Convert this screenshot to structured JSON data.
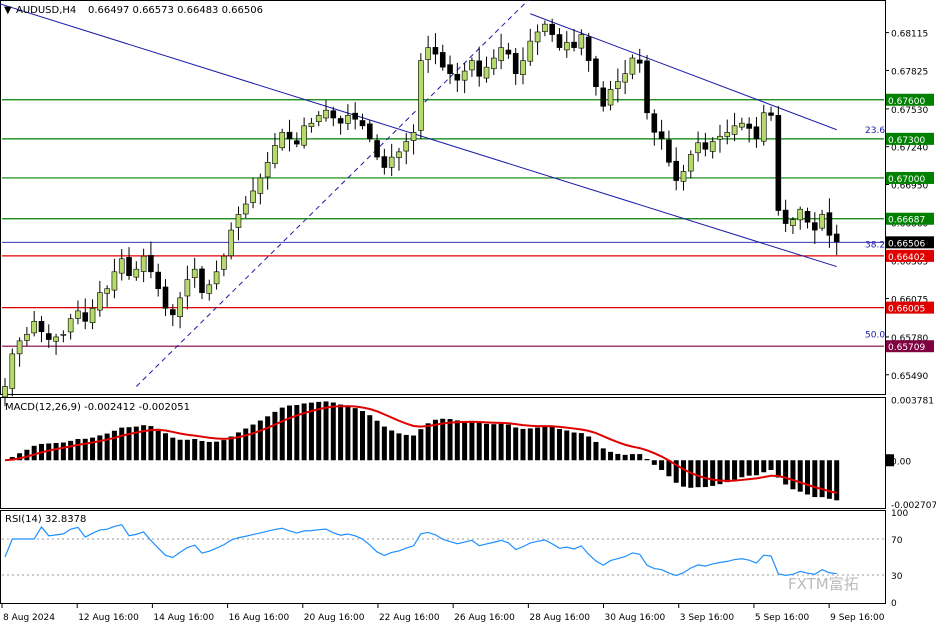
{
  "header": {
    "symbol": "AUDUSD,H4",
    "ohlc": "0.66497 0.66573 0.66483 0.66506"
  },
  "colors": {
    "background": "#ffffff",
    "bull_candle": "#b5d96a",
    "bear_candle": "#000000",
    "trend_lines": "#1a1aa8",
    "fib_green": "#008000",
    "fib_red": "#e00000",
    "fib_dark": "#800040",
    "macd_signal": "#e00000",
    "rsi": "#1e90ff",
    "price_box": "#000000"
  },
  "chart_data": [
    {
      "type": "candlestick",
      "symbol": "AUDUSD",
      "timeframe": "H4",
      "title": "AUDUSD,H4",
      "last_price": 0.66506,
      "ylim": [
        0.6535,
        0.6835
      ],
      "y_ticks": [
        "0.68115",
        "0.67825",
        "0.67530",
        "0.67240",
        "0.66950",
        "0.66660",
        "0.66365",
        "0.66075",
        "0.65780",
        "0.65490"
      ],
      "x_labels": [
        "8 Aug 2024",
        "12 Aug 16:00",
        "14 Aug 16:00",
        "16 Aug 16:00",
        "20 Aug 16:00",
        "22 Aug 16:00",
        "26 Aug 16:00",
        "28 Aug 16:00",
        "30 Aug 16:00",
        "3 Sep 16:00",
        "5 Sep 16:00",
        "9 Sep 16:00"
      ],
      "price_tags": [
        {
          "value": 0.676,
          "label": "0.67600",
          "style": "green"
        },
        {
          "value": 0.673,
          "label": "0.67300",
          "style": "green"
        },
        {
          "value": 0.67,
          "label": "0.67000",
          "style": "green"
        },
        {
          "value": 0.66687,
          "label": "0.66687",
          "style": "green"
        },
        {
          "value": 0.66506,
          "label": "0.66506",
          "style": "current"
        },
        {
          "value": 0.66402,
          "label": "0.66402",
          "style": "red"
        },
        {
          "value": 0.66005,
          "label": "0.66005",
          "style": "red"
        },
        {
          "value": 0.65709,
          "label": "0.65709",
          "style": "dark"
        }
      ],
      "fib_labels": [
        {
          "value": 0.6733,
          "label": "23.6"
        },
        {
          "value": 0.6645,
          "label": "38.2"
        },
        {
          "value": 0.6576,
          "label": "50.0"
        }
      ],
      "closes": [
        0.654,
        0.6565,
        0.6575,
        0.658,
        0.659,
        0.6582,
        0.6576,
        0.6578,
        0.658,
        0.6592,
        0.6598,
        0.659,
        0.66,
        0.6612,
        0.6615,
        0.6628,
        0.6638,
        0.6625,
        0.663,
        0.664,
        0.6628,
        0.6615,
        0.66,
        0.6595,
        0.6608,
        0.6622,
        0.663,
        0.6612,
        0.6618,
        0.6628,
        0.664,
        0.666,
        0.6672,
        0.668,
        0.669,
        0.67,
        0.6712,
        0.6725,
        0.6735,
        0.673,
        0.6726,
        0.674,
        0.6742,
        0.6748,
        0.6752,
        0.6746,
        0.6742,
        0.6748,
        0.6745,
        0.674,
        0.673,
        0.6716,
        0.6708,
        0.6716,
        0.672,
        0.6728,
        0.6735,
        0.679,
        0.68,
        0.6795,
        0.6785,
        0.678,
        0.6775,
        0.6782,
        0.679,
        0.6778,
        0.6785,
        0.6792,
        0.68,
        0.6795,
        0.678,
        0.679,
        0.6805,
        0.6812,
        0.6818,
        0.681,
        0.68,
        0.6804,
        0.68,
        0.681,
        0.679,
        0.677,
        0.6755,
        0.6768,
        0.6774,
        0.678,
        0.6792,
        0.6788,
        0.675,
        0.6735,
        0.673,
        0.6712,
        0.6698,
        0.6705,
        0.6718,
        0.6727,
        0.6722,
        0.6728,
        0.6732,
        0.6735,
        0.674,
        0.6742,
        0.6738,
        0.673,
        0.675,
        0.6748,
        0.6675,
        0.6665,
        0.6668,
        0.6676,
        0.6666,
        0.666,
        0.6672,
        0.6656,
        0.6651
      ],
      "macd": {
        "label": "MACD(12,26,9) -0.002412 -0.002051",
        "ylim": [
          -0.0029,
          0.0038
        ],
        "y_ticks": [
          "0.003781",
          "0.00",
          "-0.002707"
        ]
      },
      "rsi": {
        "label": "RSI(14) 32.8378",
        "ylim": [
          0,
          100
        ],
        "y_ticks": [
          "100",
          "70",
          "30",
          "0"
        ],
        "levels": [
          70,
          30
        ]
      }
    }
  ],
  "watermark": "FXTM富拓"
}
